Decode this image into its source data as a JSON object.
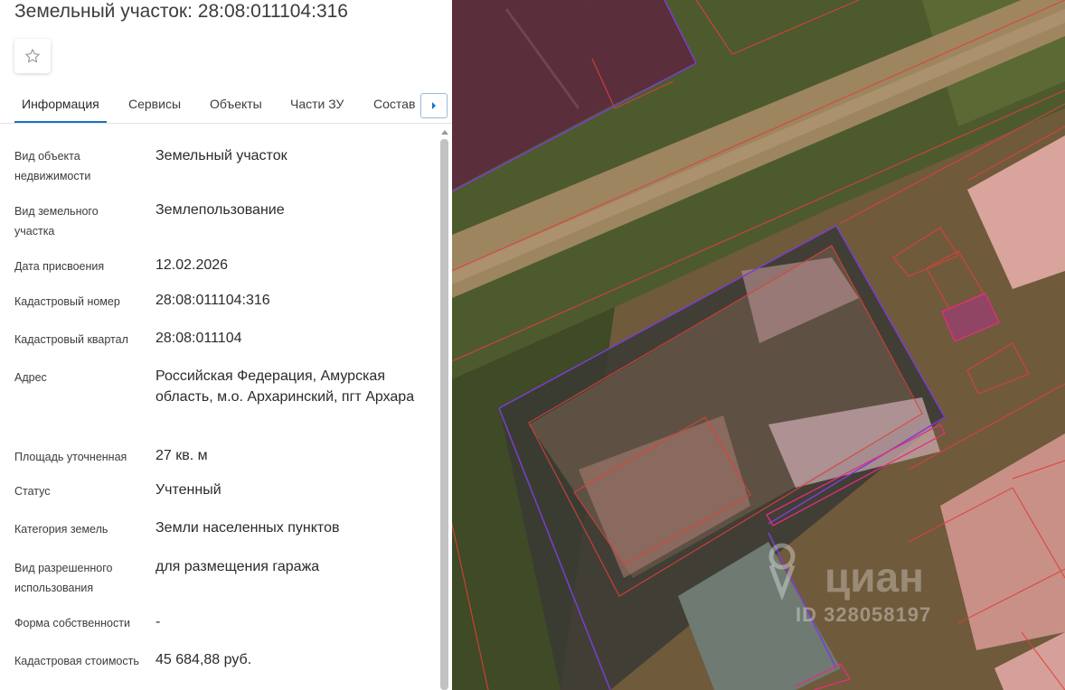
{
  "title": "Земельный участок: 28:08:011104:316",
  "tabs": [
    {
      "label": "Информация"
    },
    {
      "label": "Сервисы"
    },
    {
      "label": "Объекты"
    },
    {
      "label": "Части ЗУ"
    },
    {
      "label": "Состав"
    }
  ],
  "info": {
    "object_type": {
      "label": "Вид объекта недвижимости",
      "value": "Земельный участок"
    },
    "land_type": {
      "label": "Вид земельного участка",
      "value": "Землепользование"
    },
    "assign_date": {
      "label": "Дата присвоения",
      "value": "12.02.2026"
    },
    "cadastral_number": {
      "label": "Кадастровый номер",
      "value": "28:08:011104:316"
    },
    "cadastral_quarter": {
      "label": "Кадастровый квартал",
      "value": "28:08:011104"
    },
    "address": {
      "label": "Адрес",
      "value": "Российская Федерация, Амурская область, м.о. Архаринский, пгт Архара"
    },
    "area": {
      "label": "Площадь уточненная",
      "value": "27 кв. м"
    },
    "status": {
      "label": "Статус",
      "value": "Учтенный"
    },
    "category": {
      "label": "Категория земель",
      "value": "Земли населенных пунктов"
    },
    "permitted_use": {
      "label": "Вид разрешенного использования",
      "value": "для размещения гаража"
    },
    "ownership": {
      "label": "Форма собственности",
      "value": "-"
    },
    "cadastral_value": {
      "label": "Кадастровая стоимость",
      "value": "45 684,88 руб."
    }
  },
  "watermark": {
    "brand": "циан",
    "id_text": "ID 328058197"
  },
  "icons": {
    "favorite": "star-outline-icon",
    "tabs_next": "chevron-right-icon"
  },
  "colors": {
    "accent": "#1a73c7",
    "parcel_border": "#e0403a",
    "selected_parcel": "#7a3fd0"
  }
}
